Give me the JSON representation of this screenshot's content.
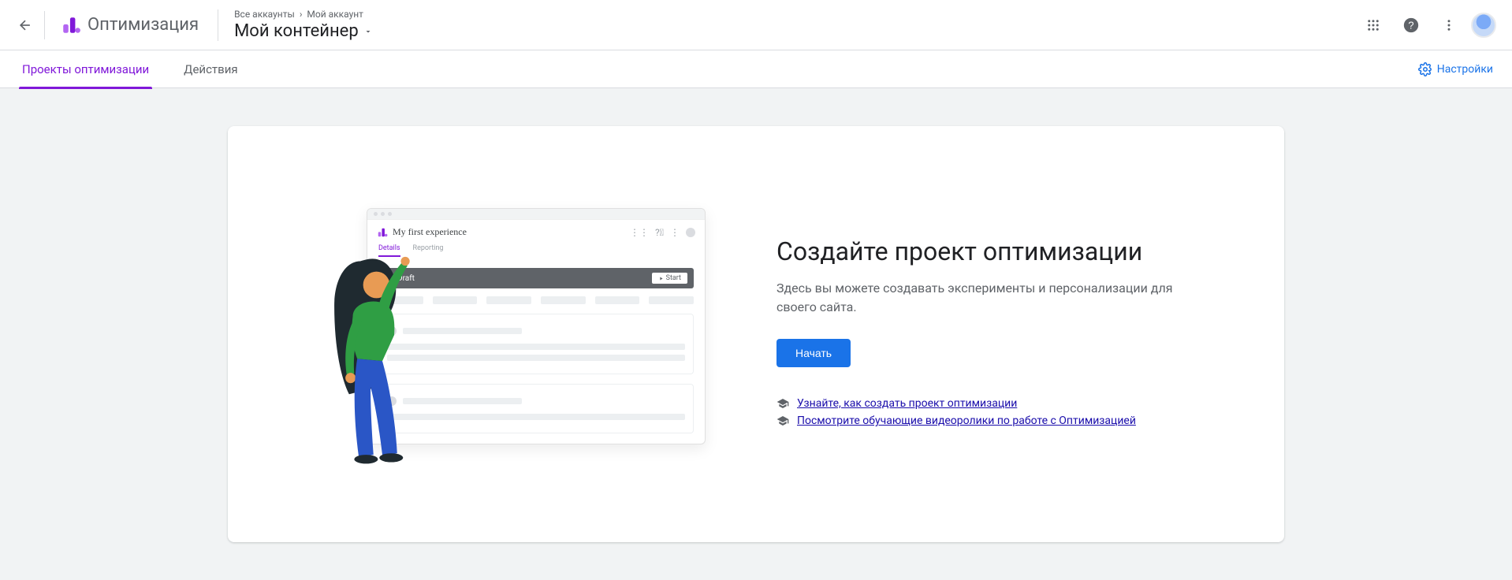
{
  "header": {
    "product_name": "Оптимизация",
    "breadcrumb": {
      "all_accounts": "Все аккаунты",
      "my_account": "Мой аккаунт"
    },
    "container_title": "Мой контейнер"
  },
  "tabs": {
    "projects": "Проекты оптимизации",
    "actions": "Действия",
    "settings": "Настройки"
  },
  "mockwin": {
    "title": "My first experience",
    "tab_details": "Details",
    "tab_reporting": "Reporting",
    "draft": "Draft",
    "start": "Start"
  },
  "hero": {
    "title": "Создайте проект оптимизации",
    "subtitle": "Здесь вы можете создавать эксперименты и персонализации для своего сайта.",
    "cta": "Начать",
    "link1": " Узнайте, как создать проект оптимизации",
    "link2": " Посмотрите обучающие видеоролики по работе с Оптимизацией"
  }
}
